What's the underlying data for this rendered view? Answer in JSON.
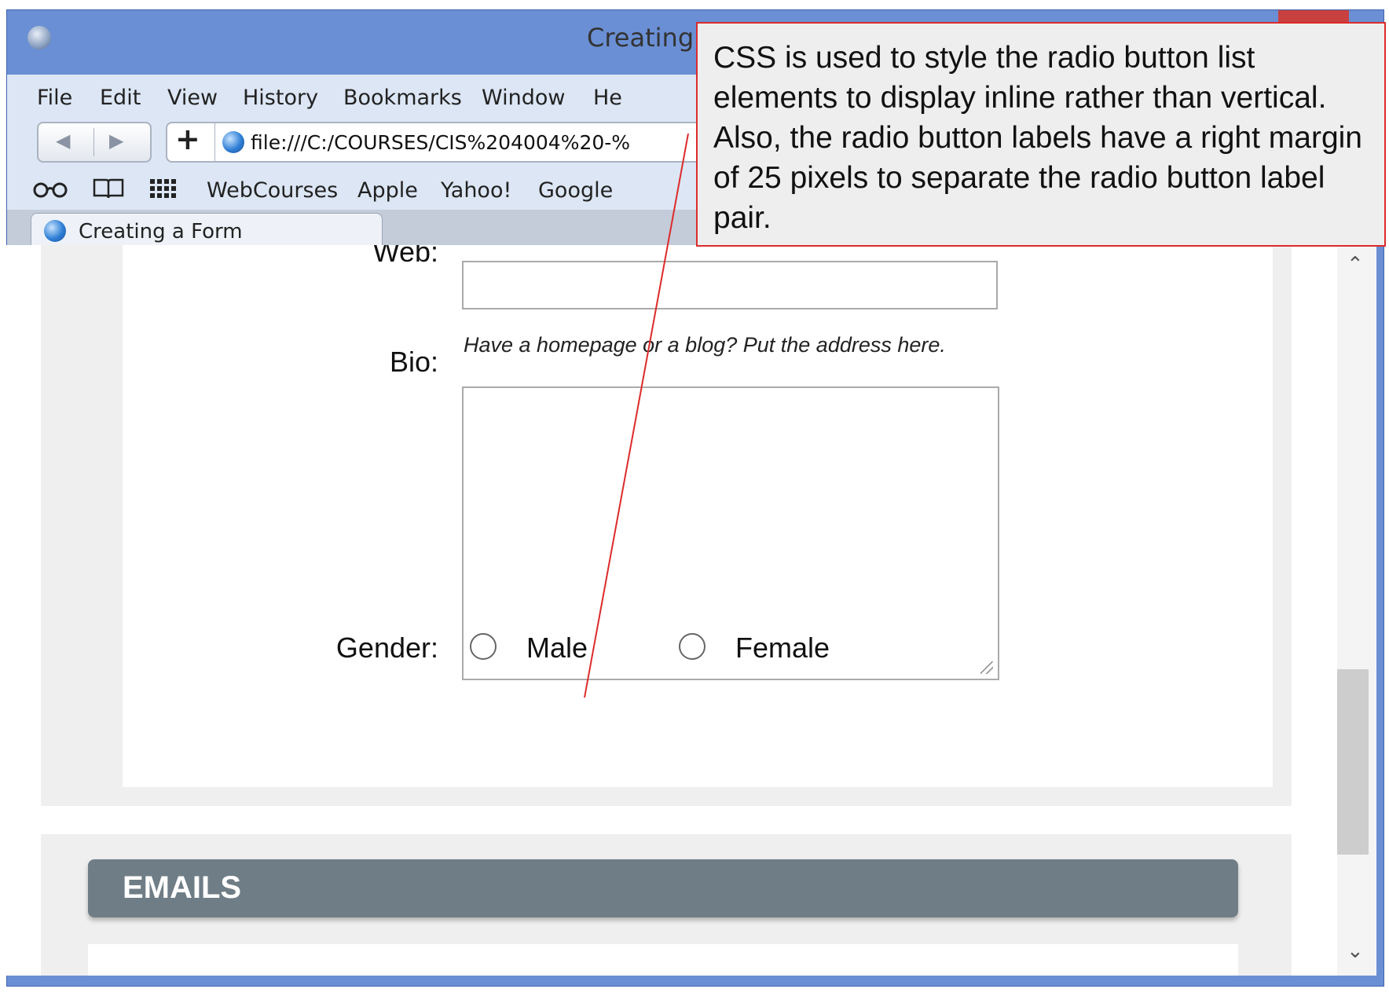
{
  "window": {
    "title": "Creating"
  },
  "menu": {
    "items": [
      "File",
      "Edit",
      "View",
      "History",
      "Bookmarks",
      "Window",
      "He"
    ]
  },
  "toolbar": {
    "back_icon": "back-arrow",
    "forward_icon": "forward-arrow",
    "add_label": "+",
    "url": "file:///C:/COURSES/CIS%204004%20-%"
  },
  "bookmarks": {
    "items": [
      "WebCourses",
      "Apple",
      "Yahoo!",
      "Google"
    ]
  },
  "tab": {
    "label": "Creating a Form"
  },
  "form": {
    "web_label": "Web:",
    "web_value": "",
    "web_hint": "Have a homepage or a blog? Put the address here.",
    "bio_label": "Bio:",
    "bio_value": "",
    "gender_label": "Gender:",
    "gender_options": [
      "Male",
      "Female"
    ]
  },
  "emails": {
    "title": "EMAILS"
  },
  "callout": {
    "text": "CSS is used to style the radio button list elements to display inline rather than vertical. Also, the radio button labels have a right margin of 25 pixels to separate the radio button label pair."
  },
  "colors": {
    "window_frame": "#6a8fd4",
    "chrome": "#dce6f4",
    "section_header": "#6f7d86",
    "callout_border": "#dd2a2a"
  }
}
